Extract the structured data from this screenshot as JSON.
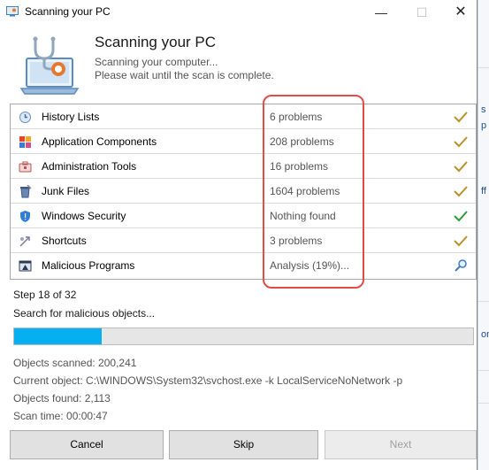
{
  "window": {
    "title": "Scanning your PC",
    "minimize_glyph": "—",
    "maximize_glyph": "☐",
    "close_glyph": "✕"
  },
  "header": {
    "title": "Scanning your PC",
    "line1": "Scanning your computer...",
    "line2": "Please wait until the scan is complete."
  },
  "scan_items": [
    {
      "label": "History Lists",
      "status": "6 problems",
      "icon": "history-icon",
      "result": "check-gold"
    },
    {
      "label": "Application Components",
      "status": "208 problems",
      "icon": "components-icon",
      "result": "check-gold"
    },
    {
      "label": "Administration Tools",
      "status": "16 problems",
      "icon": "admin-tools-icon",
      "result": "check-gold"
    },
    {
      "label": "Junk Files",
      "status": "1604 problems",
      "icon": "junk-files-icon",
      "result": "check-gold"
    },
    {
      "label": "Windows Security",
      "status": "Nothing found",
      "icon": "shield-icon",
      "result": "check-green"
    },
    {
      "label": "Shortcuts",
      "status": "3 problems",
      "icon": "shortcuts-icon",
      "result": "check-gold"
    },
    {
      "label": "Malicious Programs",
      "status": "Analysis (19%)...",
      "icon": "malicious-programs-icon",
      "result": "magnifier"
    }
  ],
  "progress": {
    "step_text": "Step 18 of 32",
    "current_task": "Search for malicious objects...",
    "fraction": 0.19,
    "fill_color": "#06b0f0"
  },
  "stats": {
    "objects_scanned": "Objects scanned: 200,241",
    "current_object": "Current object: C:\\WINDOWS\\System32\\svchost.exe -k LocalServiceNoNetwork -p",
    "objects_found": "Objects found: 2,113",
    "scan_time": "Scan time: 00:00:47"
  },
  "buttons": {
    "cancel": "Cancel",
    "skip": "Skip",
    "next": "Next"
  },
  "background_fragments": [
    "s",
    "p",
    "ff",
    "on"
  ],
  "colors": {
    "check_gold": "#b8922a",
    "check_green": "#2e9e3a",
    "highlight": "#e34a4a",
    "accent": "#06b0f0"
  }
}
